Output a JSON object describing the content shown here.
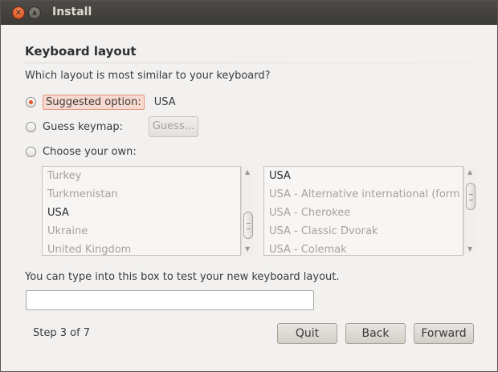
{
  "window": {
    "title": "Install"
  },
  "page": {
    "heading": "Keyboard layout",
    "question": "Which layout is most similar to your keyboard?"
  },
  "options": {
    "suggested": {
      "label": "Suggested option:",
      "value": "USA",
      "selected": true
    },
    "guess": {
      "label": "Guess keymap:",
      "button": "Guess..."
    },
    "choose": {
      "label": "Choose your own:"
    }
  },
  "country_list": {
    "items": [
      "Turkey",
      "Turkmenistan",
      "USA",
      "Ukraine",
      "United Kingdom"
    ],
    "selected": "USA",
    "scroll_position": 0.82
  },
  "variant_list": {
    "items": [
      "USA",
      "USA - Alternative international (form",
      "USA - Cherokee",
      "USA - Classic Dvorak",
      "USA - Colemak"
    ],
    "selected": "USA",
    "scroll_position": 0.1
  },
  "test": {
    "label": "You can type into this box to test your new keyboard layout.",
    "value": ""
  },
  "footer": {
    "step": "Step 3 of 7",
    "quit": "Quit",
    "back": "Back",
    "forward": "Forward"
  }
}
